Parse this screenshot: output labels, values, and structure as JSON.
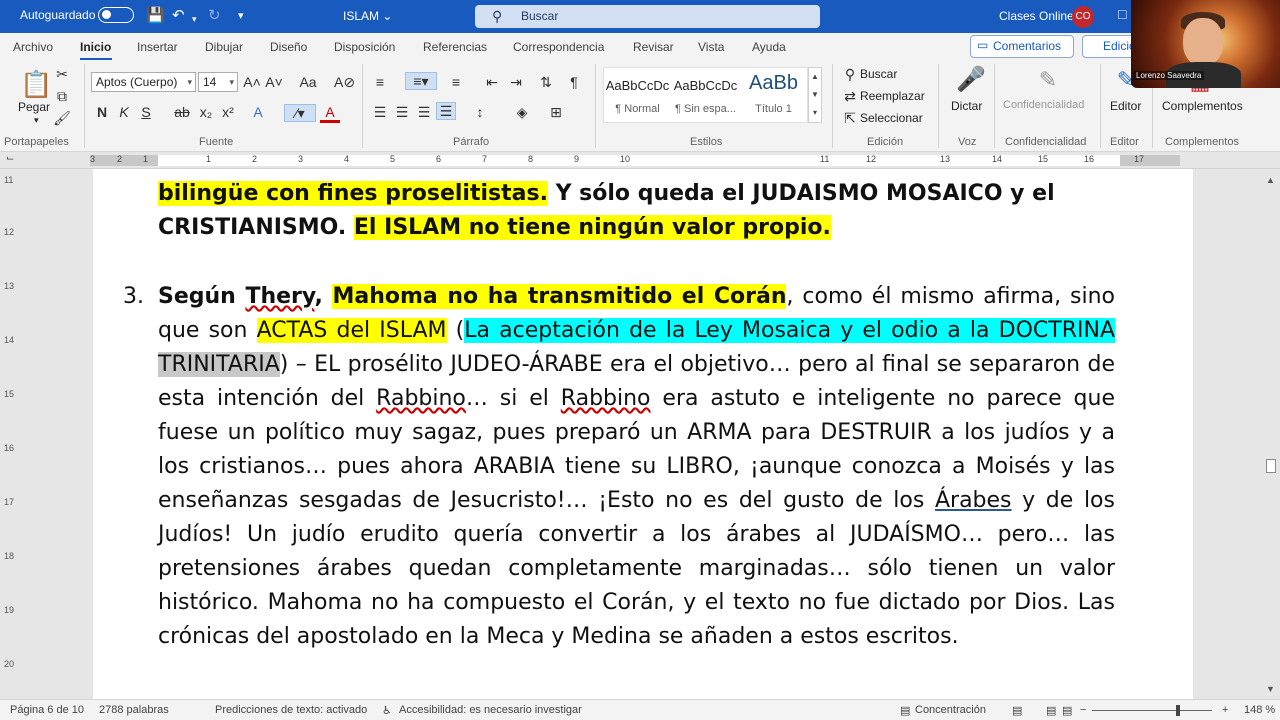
{
  "titlebar": {
    "autosave_label": "Autoguardado",
    "document_title": "ISLAM",
    "search_placeholder": "Buscar",
    "account_name": "Clases Online",
    "account_initials": "CO"
  },
  "menu": {
    "items": [
      "Archivo",
      "Inicio",
      "Insertar",
      "Dibujar",
      "Diseño",
      "Disposición",
      "Referencias",
      "Correspondencia",
      "Revisar",
      "Vista",
      "Ayuda"
    ],
    "active": "Inicio",
    "comments_label": "Comentarios",
    "edit_label": "Edición"
  },
  "ribbon": {
    "clipboard": {
      "paste_label": "Pegar",
      "group_label": "Portapapeles"
    },
    "font": {
      "font_name": "Aptos (Cuerpo)",
      "font_size": "14",
      "group_label": "Fuente"
    },
    "paragraph": {
      "group_label": "Párrafo"
    },
    "styles": {
      "tiles": [
        {
          "preview": "AaBbCcDc",
          "name": "¶ Normal"
        },
        {
          "preview": "AaBbCcDc",
          "name": "¶ Sin espa..."
        },
        {
          "preview": "AaBb",
          "name": "Título 1"
        }
      ],
      "group_label": "Estilos"
    },
    "editing": {
      "find_label": "Buscar",
      "replace_label": "Reemplazar",
      "select_label": "Seleccionar",
      "group_label": "Edición"
    },
    "voice": {
      "dictate_label": "Dictar",
      "group_label": "Voz"
    },
    "sensitivity": {
      "label": "Confidencialidad",
      "group_label": "Confidencialidad"
    },
    "editor": {
      "label": "Editor",
      "group_label": "Editor"
    },
    "addins": {
      "label": "Complementos",
      "group_label": "Complementos"
    }
  },
  "ruler": {
    "numbers": [
      "3",
      "2",
      "1",
      "1",
      "2",
      "3",
      "4",
      "5",
      "6",
      "7",
      "8",
      "9",
      "10",
      "11",
      "12",
      "13",
      "14",
      "15",
      "16",
      "17"
    ]
  },
  "vruler": {
    "numbers": [
      "11",
      "12",
      "13",
      "14",
      "15",
      "16",
      "17",
      "18",
      "19",
      "20"
    ]
  },
  "document": {
    "p1_line1_a": "bilingüe con fines proselitistas.",
    "p1_line1_b": " Y sólo queda el JUDAISMO MOSAICO y el",
    "p1_line2_a": "CRISTIANISMO. ",
    "p1_line2_b": "El ISLAM no tiene ningún valor propio.",
    "item_number": "3.",
    "p3_a": "Según ",
    "p3_thery": "Thery",
    "p3_comma": ", ",
    "p3_hl_bold": "Mahoma no ha transmitido el Corán",
    "p3_b": ", como él mismo afirma, sino que son ",
    "p3_actas": "ACTAS del ISLAM",
    "p3_paren": " (",
    "p3_cyan": "La aceptación de la Ley Mosaica y el odio a la DOCTRINA",
    "p3_trinitaria": "TRINITARIA",
    "p3_c": ") – EL prosélito JUDEO-ÁRABE era el objetivo… pero al final se separaron de esta intención del ",
    "p3_rabbino1": "Rabbino",
    "p3_d": "… si el ",
    "p3_rabbino2": "Rabbino",
    "p3_e": " era astuto e inteligente no parece que fuese un político muy sagaz, pues preparó un ARMA para DESTRUIR a los judíos y a los cristianos… pues ahora ARABIA tiene su LIBRO, ¡aunque conozca a Moisés y las enseñanzas sesgadas de Jesucristo!… ¡Esto no es del gusto de los ",
    "p3_arabes": "Árabes",
    "p3_f": " y de los Judíos! Un judío erudito quería convertir a los árabes al JUDAÍSMO… pero… las pretensiones árabes quedan completamente marginadas… sólo tienen un valor histórico. Mahoma no ha compuesto el Corán, y el texto no fue dictado por Dios. Las crónicas del apostolado en la Meca y Medina se añaden a estos escritos."
  },
  "status": {
    "page": "Página 6 de 10",
    "words": "2788 palabras",
    "predictions": "Predicciones de texto: activado",
    "accessibility": "Accesibilidad: es necesario investigar",
    "focus": "Concentración",
    "zoom": "148 %"
  },
  "webcam": {
    "caption": "Lorenzo Saavedra"
  }
}
